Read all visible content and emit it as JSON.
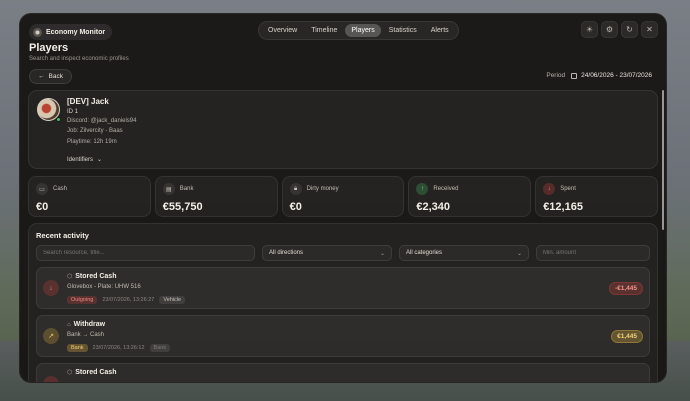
{
  "app": {
    "name": "Economy Monitor"
  },
  "nav": {
    "tabs": [
      "Overview",
      "Timeline",
      "Players",
      "Statistics",
      "Alerts"
    ],
    "active": "Players"
  },
  "top_icons": [
    "sun-icon",
    "gear-icon",
    "refresh-icon",
    "close-icon"
  ],
  "page": {
    "title": "Players",
    "subtitle": "Search and inspect economic profiles"
  },
  "back_label": "Back",
  "period": {
    "label": "Period",
    "value": "24/06/2026 - 23/07/2026"
  },
  "profile": {
    "name": "[DEV] Jack",
    "id": "ID 1",
    "discord": "Discord: @jack_daniels94",
    "job": "Job: Zilvercity - Baas",
    "playtime": "Playtime: 12h 19m",
    "identifiers_label": "Identifiers",
    "online": true
  },
  "stats": [
    {
      "label": "Cash",
      "value": "€0",
      "icon": "wallet-icon",
      "tone": "neutral"
    },
    {
      "label": "Bank",
      "value": "€55,750",
      "icon": "card-icon",
      "tone": "neutral"
    },
    {
      "label": "Dirty money",
      "value": "€0",
      "icon": "lock-icon",
      "tone": "neutral"
    },
    {
      "label": "Received",
      "value": "€2,340",
      "icon": "arrow-up-icon",
      "tone": "green"
    },
    {
      "label": "Spent",
      "value": "€12,165",
      "icon": "arrow-down-icon",
      "tone": "red"
    }
  ],
  "activity": {
    "title": "Recent activity",
    "search_placeholder": "Search resource, title...",
    "direction_filter": "All directions",
    "category_filter": "All categories",
    "amount_placeholder": "Min. amount",
    "rows": [
      {
        "title": "Stored Cash",
        "detail": "Glovebox - Plate: UHW 516",
        "badge": "Outgoing",
        "timestamp": "23/07/2026, 13:26:27",
        "tag": "Vehicle",
        "amount": "-€1,445",
        "direction": "out"
      },
      {
        "title": "Withdraw",
        "detail": "Bank → Cash",
        "badge": "Bank",
        "timestamp": "23/07/2026, 13:26:12",
        "tag": "Bank",
        "amount": "€1,445",
        "direction": "in"
      },
      {
        "title": "Stored Cash",
        "detail": "",
        "badge": "",
        "timestamp": "",
        "tag": "",
        "amount": "",
        "direction": "out"
      }
    ]
  }
}
